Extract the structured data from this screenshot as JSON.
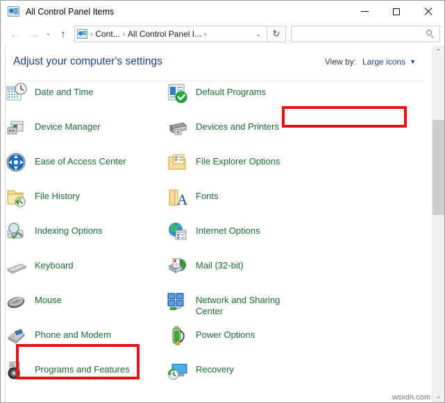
{
  "window": {
    "title": "All Control Panel Items",
    "icon": "control-panel-icon",
    "controls": {
      "minimize": "minimize-icon",
      "maximize": "maximize-icon",
      "close": "close-icon"
    }
  },
  "navbar": {
    "back": "back-arrow-icon",
    "forward": "forward-arrow-icon",
    "recent": "recent-locations-icon",
    "up": "up-arrow-icon",
    "breadcrumb": {
      "icon": "control-panel-icon",
      "sep1": "›",
      "item1": "Cont...",
      "sep2": "›",
      "item2": "All Control Panel I...",
      "sep3": "›",
      "dropdown": "⌄"
    },
    "refresh": "↻",
    "search": {
      "value": "",
      "placeholder": "",
      "icon": "search-icon"
    }
  },
  "content": {
    "heading": "Adjust your computer's settings",
    "view_by": {
      "label": "View by:",
      "value": "Large icons",
      "caret": "▼"
    }
  },
  "items": [
    {
      "label": "Date and Time",
      "icon": "date-and-time-icon",
      "col": 0,
      "row": 0
    },
    {
      "label": "Default Programs",
      "icon": "default-programs-icon",
      "col": 1,
      "row": 0
    },
    {
      "label": "Device Manager",
      "icon": "device-manager-icon",
      "col": 0,
      "row": 1
    },
    {
      "label": "Devices and Printers",
      "icon": "devices-and-printers-icon",
      "col": 1,
      "row": 1
    },
    {
      "label": "Ease of Access Center",
      "icon": "ease-of-access-center-icon",
      "col": 0,
      "row": 2
    },
    {
      "label": "File Explorer Options",
      "icon": "file-explorer-options-icon",
      "col": 1,
      "row": 2
    },
    {
      "label": "File History",
      "icon": "file-history-icon",
      "col": 0,
      "row": 3
    },
    {
      "label": "Fonts",
      "icon": "fonts-icon",
      "col": 1,
      "row": 3
    },
    {
      "label": "Indexing Options",
      "icon": "indexing-options-icon",
      "col": 0,
      "row": 4
    },
    {
      "label": "Internet Options",
      "icon": "internet-options-icon",
      "col": 1,
      "row": 4
    },
    {
      "label": "Keyboard",
      "icon": "keyboard-icon",
      "col": 0,
      "row": 5
    },
    {
      "label": "Mail (32-bit)",
      "icon": "mail-icon",
      "col": 1,
      "row": 5
    },
    {
      "label": "Mouse",
      "icon": "mouse-icon",
      "col": 0,
      "row": 6
    },
    {
      "label": "Network and Sharing\nCenter",
      "icon": "network-and-sharing-center-icon",
      "col": 1,
      "row": 6
    },
    {
      "label": "Phone and Modem",
      "icon": "phone-and-modem-icon",
      "col": 0,
      "row": 7
    },
    {
      "label": "Power Options",
      "icon": "power-options-icon",
      "col": 1,
      "row": 7
    },
    {
      "label": "Programs and Features",
      "icon": "programs-and-features-icon",
      "col": 0,
      "row": 8
    },
    {
      "label": "Recovery",
      "icon": "recovery-icon",
      "col": 1,
      "row": 8
    }
  ],
  "annotations": {
    "highlight_view_by": "View by: Large icons",
    "highlight_mouse": "Mouse",
    "color": "#e81010"
  },
  "scrollbar": {
    "up": "⌃",
    "down": "⌄"
  },
  "watermark": "wsxdn.com",
  "colors": {
    "item_label": "#1a6b33",
    "heading": "#1f3f8c",
    "annotation": "#e81010"
  }
}
